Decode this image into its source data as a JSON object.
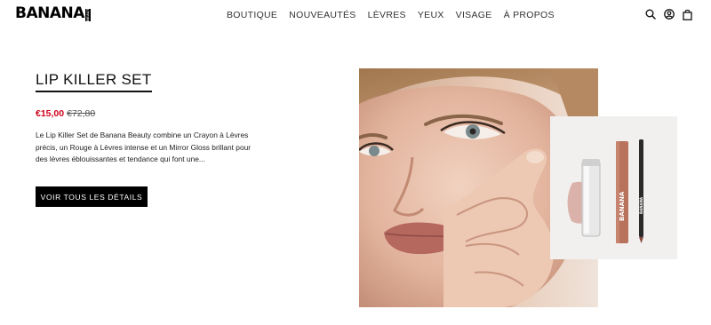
{
  "brand": {
    "logo_text": "BANANA",
    "logo_sub": "BEAUTY"
  },
  "nav": {
    "items": [
      "BOUTIQUE",
      "NOUVEAUTÉS",
      "LÈVRES",
      "YEUX",
      "VISAGE",
      "À PROPOS"
    ]
  },
  "header_icons": [
    "search-icon",
    "account-icon",
    "bag-icon"
  ],
  "product": {
    "title": "LIP KILLER SET",
    "price_sale": "€15,00",
    "price_old": "€72,80",
    "description": "Le Lip Killer Set de Banana Beauty combine un Crayon à Lèvres précis, un Rouge à Lèvres intense et un Mirror Gloss brillant pour des lèvres éblouissantes et tendance qui font une...",
    "cta_label": "VOIR TOUS LES DÉTAILS"
  },
  "images": {
    "inset_lipstick_brand": "BANANA",
    "inset_pencil_brand": "BANANA"
  },
  "colors": {
    "sale_price": "#d0011b",
    "cta_bg": "#000000",
    "text": "#111111"
  }
}
